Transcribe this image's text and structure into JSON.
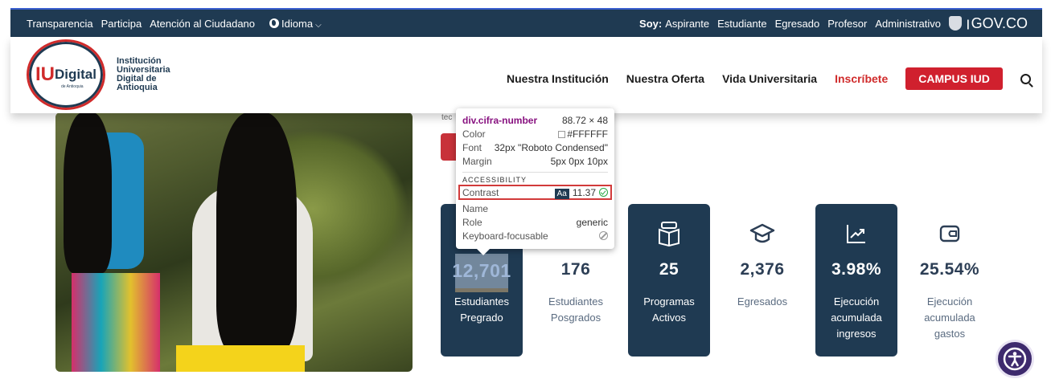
{
  "topbar": {
    "links": [
      "Transparencia",
      "Participa",
      "Atención al Ciudadano"
    ],
    "language_label": "Idioma",
    "soy_label": "Soy:",
    "roles": [
      "Aspirante",
      "Estudiante",
      "Egresado",
      "Profesor",
      "Administrativo"
    ],
    "gov_label": "GOV.CO"
  },
  "header": {
    "logo_iu": "IU",
    "logo_digital": "Digital",
    "logo_small": "de Antioquia",
    "logo_text": [
      "Institución",
      "Universitaria",
      "Digital de",
      "Antioquia"
    ],
    "nav": [
      "Nuestra Institución",
      "Nuestra Oferta",
      "Vida Universitaria"
    ],
    "inscribete": "Inscríbete",
    "campus": "CAMPUS IUD"
  },
  "peek_text": "tec",
  "stats": [
    {
      "number": "12,701",
      "label": [
        "Estudiantes",
        "Pregrado"
      ],
      "style": "dark",
      "icon": "students-icon"
    },
    {
      "number": "176",
      "label": [
        "Estudiantes",
        "Posgrados"
      ],
      "style": "light",
      "icon": "postgrad-icon"
    },
    {
      "number": "25",
      "label": [
        "Programas",
        "Activos"
      ],
      "style": "dark",
      "icon": "book-icon"
    },
    {
      "number": "2,376",
      "label": [
        "Egresados"
      ],
      "style": "light",
      "icon": "graduation-cap-icon"
    },
    {
      "number": "3.98%",
      "label": [
        "Ejecución",
        "acumulada",
        "ingresos"
      ],
      "style": "dark",
      "icon": "trend-chart-icon"
    },
    {
      "number": "25.54%",
      "label": [
        "Ejecución",
        "acumulada",
        "gastos"
      ],
      "style": "light",
      "icon": "wallet-icon"
    }
  ],
  "tooltip": {
    "selector": "div.cifra-number",
    "dimensions": "88.72 × 48",
    "color_key": "Color",
    "color_value": "#FFFFFF",
    "font_key": "Font",
    "font_value": "32px \"Roboto Condensed\"",
    "margin_key": "Margin",
    "margin_value": "5px 0px 10px",
    "section": "ACCESSIBILITY",
    "contrast_key": "Contrast",
    "contrast_badge": "Aa",
    "contrast_value": "11.37",
    "name_key": "Name",
    "role_key": "Role",
    "role_value": "generic",
    "focus_key": "Keyboard-focusable"
  },
  "colors": {
    "brand_navy": "#1f3a52",
    "brand_red": "#d0202e",
    "a11y_purple": "#3d2a6d"
  }
}
